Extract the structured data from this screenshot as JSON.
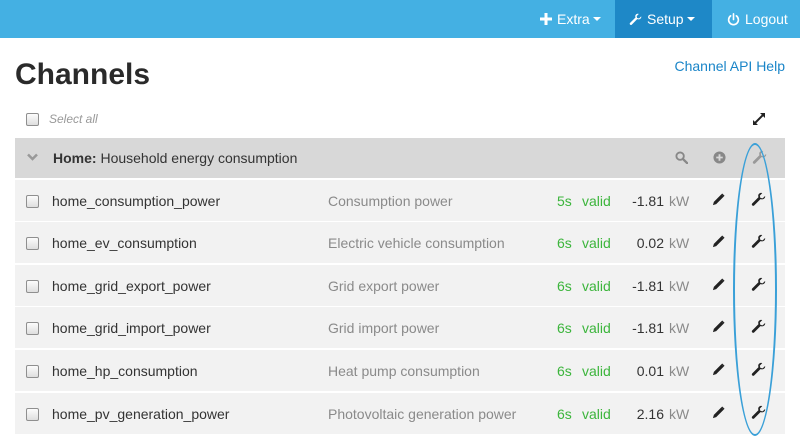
{
  "nav": {
    "extra": "Extra",
    "setup": "Setup",
    "logout": "Logout"
  },
  "page": {
    "title": "Channels",
    "help_link": "Channel API Help",
    "select_all": "Select all"
  },
  "group": {
    "name": "Home:",
    "description": "Household energy consumption"
  },
  "channels": [
    {
      "name": "home_consumption_power",
      "description": "Consumption power",
      "age": "5s",
      "status": "valid",
      "value": "-1.81",
      "unit": "kW"
    },
    {
      "name": "home_ev_consumption",
      "description": "Electric vehicle consumption",
      "age": "6s",
      "status": "valid",
      "value": "0.02",
      "unit": "kW"
    },
    {
      "name": "home_grid_export_power",
      "description": "Grid export power",
      "age": "6s",
      "status": "valid",
      "value": "-1.81",
      "unit": "kW"
    },
    {
      "name": "home_grid_import_power",
      "description": "Grid import power",
      "age": "6s",
      "status": "valid",
      "value": "-1.81",
      "unit": "kW"
    },
    {
      "name": "home_hp_consumption",
      "description": "Heat pump consumption",
      "age": "6s",
      "status": "valid",
      "value": "0.01",
      "unit": "kW"
    },
    {
      "name": "home_pv_generation_power",
      "description": "Photovoltaic generation power",
      "age": "6s",
      "status": "valid",
      "value": "2.16",
      "unit": "kW"
    }
  ],
  "icons": {
    "extra": "plus-icon",
    "setup": "wrench-icon",
    "logout": "power-icon",
    "expand": "expand-icon",
    "group_toggle": "chevron-down-icon",
    "search": "search-icon",
    "add": "plus-circle-icon",
    "edit": "pencil-icon",
    "configure": "wrench-icon"
  },
  "colors": {
    "nav_bg": "#44b0e3",
    "nav_active": "#1e88c7",
    "link": "#1a85c8",
    "valid": "#3cb53c",
    "annotation": "#3aa0d8"
  }
}
